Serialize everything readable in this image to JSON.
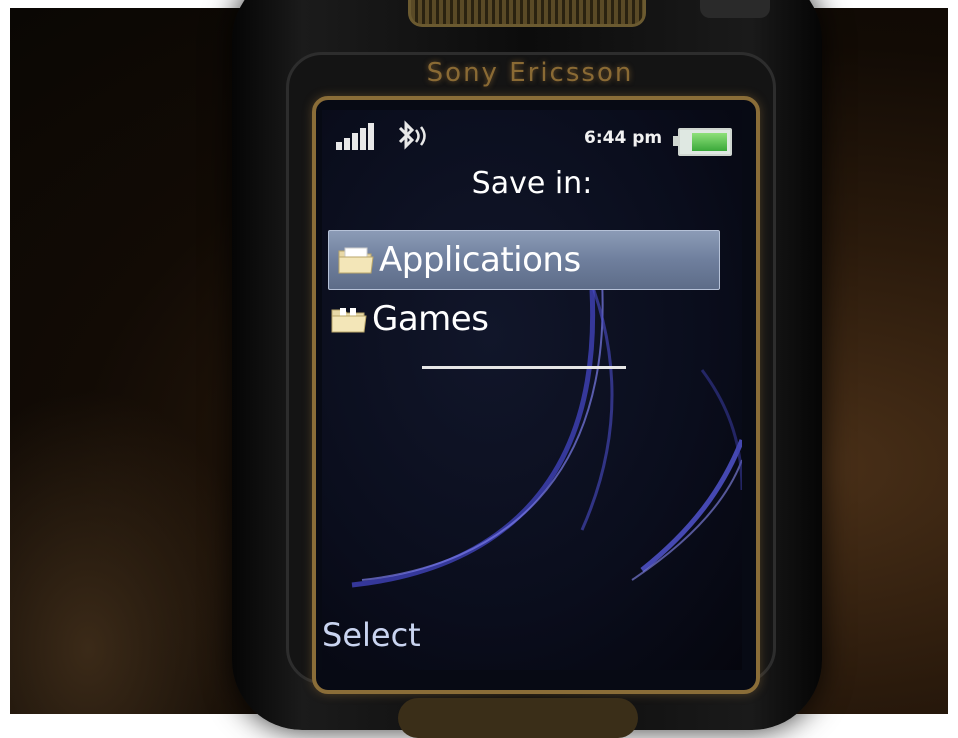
{
  "device": {
    "brand": "Sony Ericsson"
  },
  "status_bar": {
    "signal_bars": 5,
    "time": "6:44 pm",
    "battery_level": 0.8,
    "battery_color": "#3aa83a"
  },
  "screen": {
    "title": "Save in:",
    "folders": [
      {
        "label": "Applications",
        "icon": "folder-icon",
        "selected": true
      },
      {
        "label": "Games",
        "icon": "folder-icon",
        "selected": false
      }
    ],
    "highlight_color": "#6f7f9d"
  },
  "softkeys": {
    "left": "Select"
  }
}
